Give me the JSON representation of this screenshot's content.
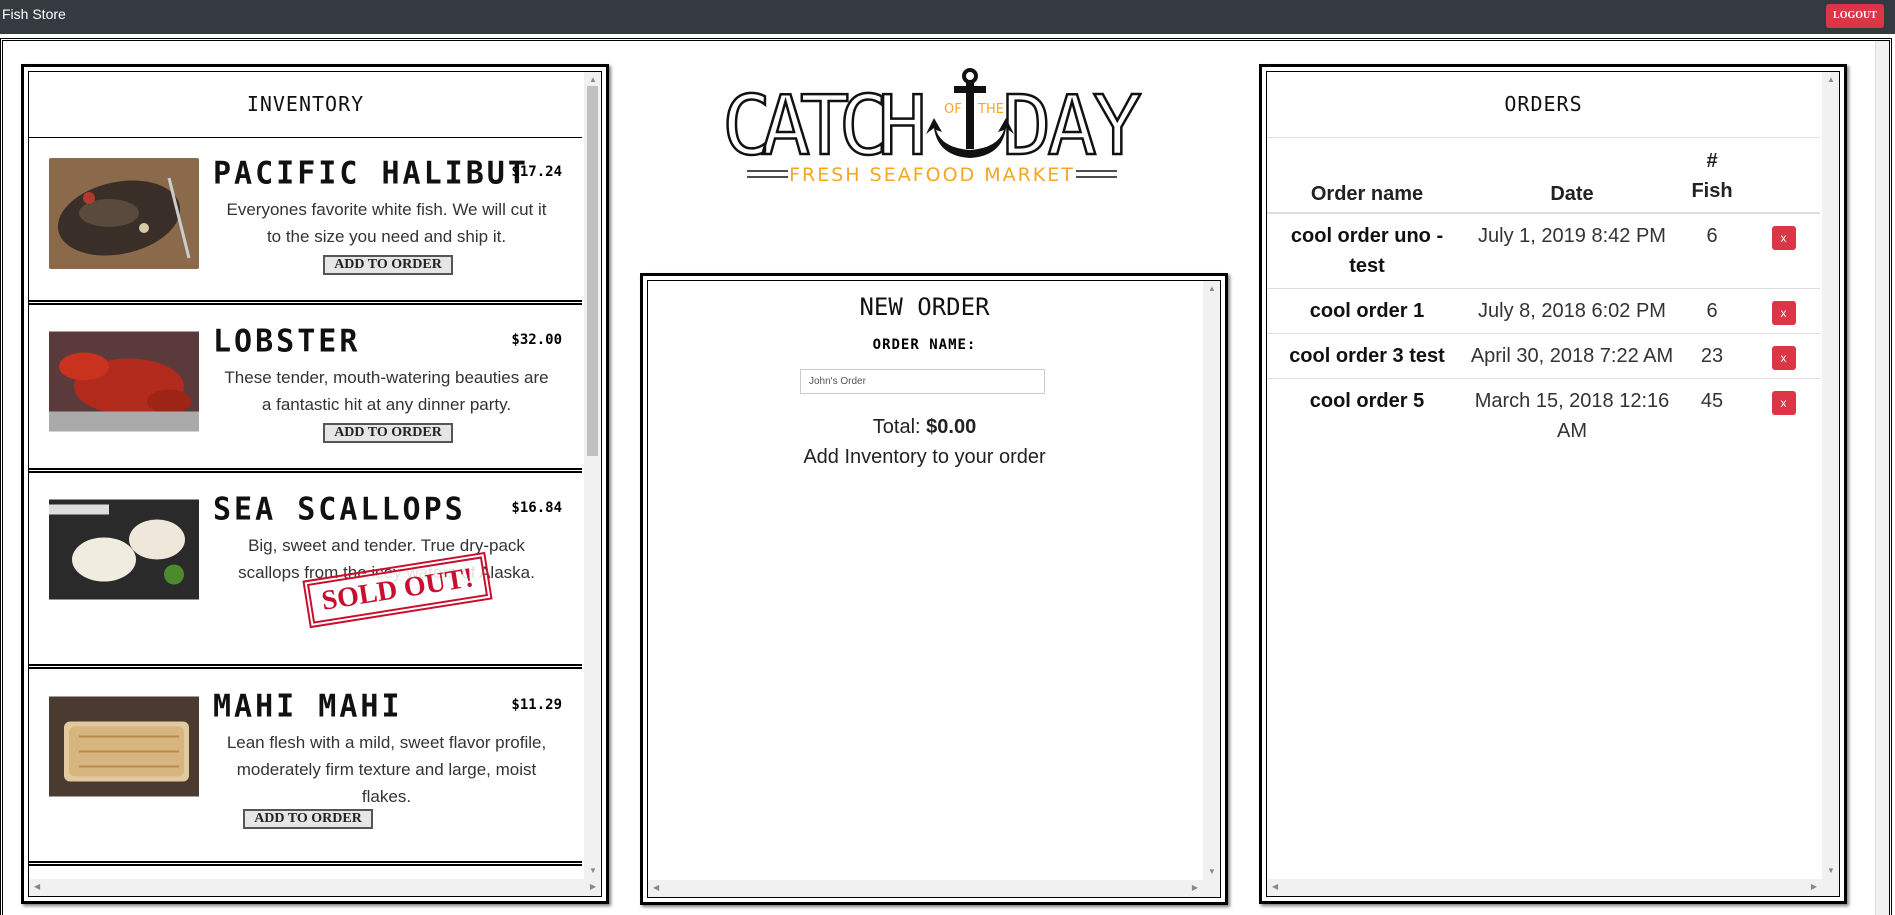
{
  "topbar": {
    "title": "Fish Store",
    "logout_label": "LOGOUT"
  },
  "inventory": {
    "title": "INVENTORY",
    "items": [
      {
        "name": "PACIFIC HALIBUT",
        "price": "$17.24",
        "desc_lines": [
          "Everyones favorite white fish. We will cut it",
          "to the size you need and ship it."
        ],
        "button": "ADD TO ORDER",
        "sold_out": false
      },
      {
        "name": "LOBSTER",
        "price": "$32.00",
        "desc_lines": [
          "These tender, mouth-watering beauties are",
          "a fantastic hit at any dinner party."
        ],
        "button": "ADD TO ORDER",
        "sold_out": false
      },
      {
        "name": "SEA SCALLOPS",
        "price": "$16.84",
        "desc_lines": [
          "Big, sweet and tender. True dry-pack",
          "scallops from the icey waters of Alaska."
        ],
        "button": "",
        "sold_out": true,
        "sold_out_label": "SOLD OUT!"
      },
      {
        "name": "MAHI MAHI",
        "price": "$11.29",
        "desc_lines": [
          "Lean flesh with a mild, sweet flavor profile,",
          "moderately firm texture and large, moist",
          "flakes."
        ],
        "button": "ADD TO ORDER",
        "sold_out": false
      }
    ]
  },
  "logo": {
    "word1": "CATCH",
    "of": "OF",
    "the": "THE",
    "word2": "DAY",
    "tagline": "FRESH SEAFOOD MARKET",
    "accent": "#f5a623"
  },
  "new_order": {
    "title": "NEW ORDER",
    "name_label": "ORDER NAME:",
    "name_placeholder": "John's Order",
    "total_label": "Total:",
    "total_value": "$0.00",
    "empty_message": "Add Inventory to your order"
  },
  "orders": {
    "title": "ORDERS",
    "headers": {
      "name": "Order name",
      "date": "Date",
      "fish_hash": "#",
      "fish": "Fish"
    },
    "rows": [
      {
        "name_lines": [
          "cool order uno -",
          "test"
        ],
        "date_lines": [
          "July 1, 2019 8:42 PM"
        ],
        "fish": "6",
        "delete": "x"
      },
      {
        "name_lines": [
          "cool order 1"
        ],
        "date_lines": [
          "July 8, 2018 6:02 PM"
        ],
        "fish": "6",
        "delete": "x"
      },
      {
        "name_lines": [
          "cool order 3 test"
        ],
        "date_lines": [
          "April 30, 2018 7:22 AM"
        ],
        "fish": "23",
        "delete": "x"
      },
      {
        "name_lines": [
          "cool order 5"
        ],
        "date_lines": [
          "March 15, 2018 12:16",
          "AM"
        ],
        "fish": "45",
        "delete": "x"
      }
    ]
  },
  "colors": {
    "topbar": "#343a40",
    "danger": "#dc3545",
    "accent": "#f5a623"
  }
}
